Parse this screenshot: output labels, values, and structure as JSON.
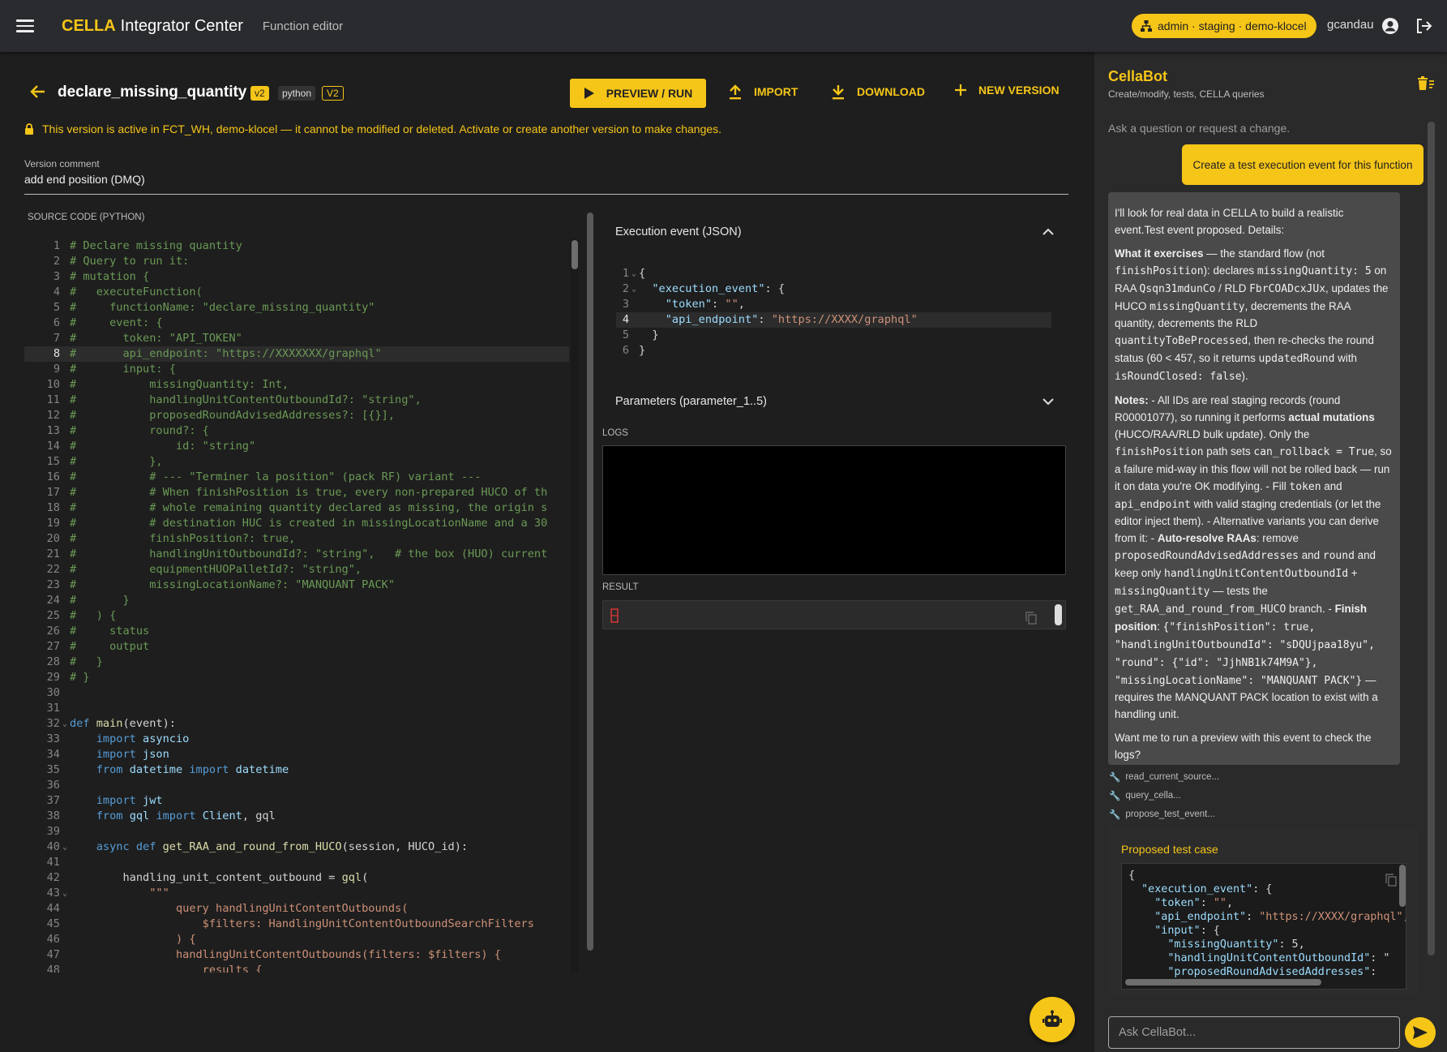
{
  "header": {
    "brand": "CELLA",
    "app_title": "Integrator Center",
    "subtitle": "Function editor",
    "env_badge": "admin · staging · demo-klocel",
    "username": "gcandau"
  },
  "function": {
    "name": "declare_missing_quantity",
    "version_chip": "v2",
    "language_chip": "python",
    "version_tag": "V2"
  },
  "toolbar": {
    "preview_run": "PREVIEW / RUN",
    "import": "IMPORT",
    "download": "DOWNLOAD",
    "new_version": "NEW VERSION"
  },
  "warning": "This version is active in FCT_WH, demo-klocel — it cannot be modified or deleted. Activate or create another version to make changes.",
  "version_comment": {
    "label": "Version comment",
    "value": "add end position (DMQ)"
  },
  "source_code_label": "SOURCE CODE (PYTHON)",
  "source_code": [
    {
      "n": "1",
      "t": "# Declare missing quantity",
      "c": "com"
    },
    {
      "n": "2",
      "t": "# Query to run it:",
      "c": "com"
    },
    {
      "n": "3",
      "t": "# mutation {",
      "c": "com"
    },
    {
      "n": "4",
      "t": "#   executeFunction(",
      "c": "com"
    },
    {
      "n": "5",
      "t": "#     functionName: \"declare_missing_quantity\"",
      "c": "com"
    },
    {
      "n": "6",
      "t": "#     event: {",
      "c": "com"
    },
    {
      "n": "7",
      "t": "#       token: \"API_TOKEN\"",
      "c": "com"
    },
    {
      "n": "8",
      "t": "#       api_endpoint: \"https://XXXXXXX/graphql\"",
      "c": "com",
      "hl": true
    },
    {
      "n": "9",
      "t": "#       input: {",
      "c": "com"
    },
    {
      "n": "10",
      "t": "#           missingQuantity: Int,",
      "c": "com"
    },
    {
      "n": "11",
      "t": "#           handlingUnitContentOutboundId?: \"string\",",
      "c": "com"
    },
    {
      "n": "12",
      "t": "#           proposedRoundAdvisedAddresses?: [{}],",
      "c": "com"
    },
    {
      "n": "13",
      "t": "#           round?: {",
      "c": "com"
    },
    {
      "n": "14",
      "t": "#               id: \"string\"",
      "c": "com"
    },
    {
      "n": "15",
      "t": "#           },",
      "c": "com"
    },
    {
      "n": "16",
      "t": "#           # --- \"Terminer la position\" (pack RF) variant ---",
      "c": "com"
    },
    {
      "n": "17",
      "t": "#           # When finishPosition is true, every non-prepared HUCO of th",
      "c": "com"
    },
    {
      "n": "18",
      "t": "#           # whole remaining quantity declared as missing, the origin s",
      "c": "com"
    },
    {
      "n": "19",
      "t": "#           # destination HUC is created in missingLocationName and a 30",
      "c": "com"
    },
    {
      "n": "20",
      "t": "#           finishPosition?: true,",
      "c": "com"
    },
    {
      "n": "21",
      "t": "#           handlingUnitOutboundId?: \"string\",   # the box (HUO) current",
      "c": "com"
    },
    {
      "n": "22",
      "t": "#           equipmentHUOPalletId?: \"string\",",
      "c": "com"
    },
    {
      "n": "23",
      "t": "#           missingLocationName?: \"MANQUANT PACK\"",
      "c": "com"
    },
    {
      "n": "24",
      "t": "#       }",
      "c": "com"
    },
    {
      "n": "25",
      "t": "#   ) {",
      "c": "com"
    },
    {
      "n": "26",
      "t": "#     status",
      "c": "com"
    },
    {
      "n": "27",
      "t": "#     output",
      "c": "com"
    },
    {
      "n": "28",
      "t": "#   }",
      "c": "com"
    },
    {
      "n": "29",
      "t": "# }",
      "c": "com"
    },
    {
      "n": "30",
      "t": "",
      "c": ""
    },
    {
      "n": "31",
      "t": "",
      "c": ""
    },
    {
      "n": "32",
      "t": "def main(event):",
      "c": "def",
      "fold": true
    },
    {
      "n": "33",
      "t": "    import asyncio",
      "c": "imp"
    },
    {
      "n": "34",
      "t": "    import json",
      "c": "imp"
    },
    {
      "n": "35",
      "t": "    from datetime import datetime",
      "c": "from"
    },
    {
      "n": "36",
      "t": "",
      "c": ""
    },
    {
      "n": "37",
      "t": "    import jwt",
      "c": "imp"
    },
    {
      "n": "38",
      "t": "    from gql import Client, gql",
      "c": "from"
    },
    {
      "n": "39",
      "t": "",
      "c": ""
    },
    {
      "n": "40",
      "t": "    async def get_RAA_and_round_from_HUCO(session, HUCO_id):",
      "c": "adef",
      "fold": true
    },
    {
      "n": "41",
      "t": "",
      "c": ""
    },
    {
      "n": "42",
      "t": "        handling_unit_content_outbound = gql(",
      "c": "plain"
    },
    {
      "n": "43",
      "t": "            \"\"\"",
      "c": "str",
      "fold": true
    },
    {
      "n": "44",
      "t": "                query handlingUnitContentOutbounds(",
      "c": "str"
    },
    {
      "n": "45",
      "t": "                    $filters: HandlingUnitContentOutboundSearchFilters",
      "c": "str"
    },
    {
      "n": "46",
      "t": "                ) {",
      "c": "str"
    },
    {
      "n": "47",
      "t": "                handlingUnitContentOutbounds(filters: $filters) {",
      "c": "str"
    },
    {
      "n": "48",
      "t": "                    results {",
      "c": "str"
    }
  ],
  "execution_event": {
    "title": "Execution event (JSON)",
    "lines": [
      {
        "n": "1",
        "fold": true,
        "t": "{"
      },
      {
        "n": "2",
        "fold": true,
        "t": "  \"execution_event\": {"
      },
      {
        "n": "3",
        "t": "    \"token\": \"\","
      },
      {
        "n": "4",
        "t": "    \"api_endpoint\": \"https://XXXX/graphql\"",
        "hl": true
      },
      {
        "n": "5",
        "t": "  }"
      },
      {
        "n": "6",
        "t": "}"
      }
    ]
  },
  "parameters_title": "Parameters (parameter_1..5)",
  "logs_label": "LOGS",
  "result_label": "RESULT",
  "chat": {
    "title": "CellaBot",
    "subtitle": "Create/modify, tests, CELLA queries",
    "hint": "Ask a question or request a change.",
    "user_message": "Create a test execution event for this function",
    "tools": [
      "read_current_source...",
      "query_cella...",
      "propose_test_event..."
    ],
    "proposed_title": "Proposed test case",
    "proposed_code": "{\n  \"execution_event\": {\n    \"token\": \"\",\n    \"api_endpoint\": \"https://XXXX/graphql\",\n    \"input\": {\n      \"missingQuantity\": 5,\n      \"handlingUnitContentOutboundId\": \"\n      \"proposedRoundAdvisedAddresses\":",
    "input_placeholder": "Ask CellaBot..."
  },
  "colors": {
    "accent": "#f5c518",
    "background": "#1e1e1e",
    "chat_background": "#2a2a2a"
  }
}
